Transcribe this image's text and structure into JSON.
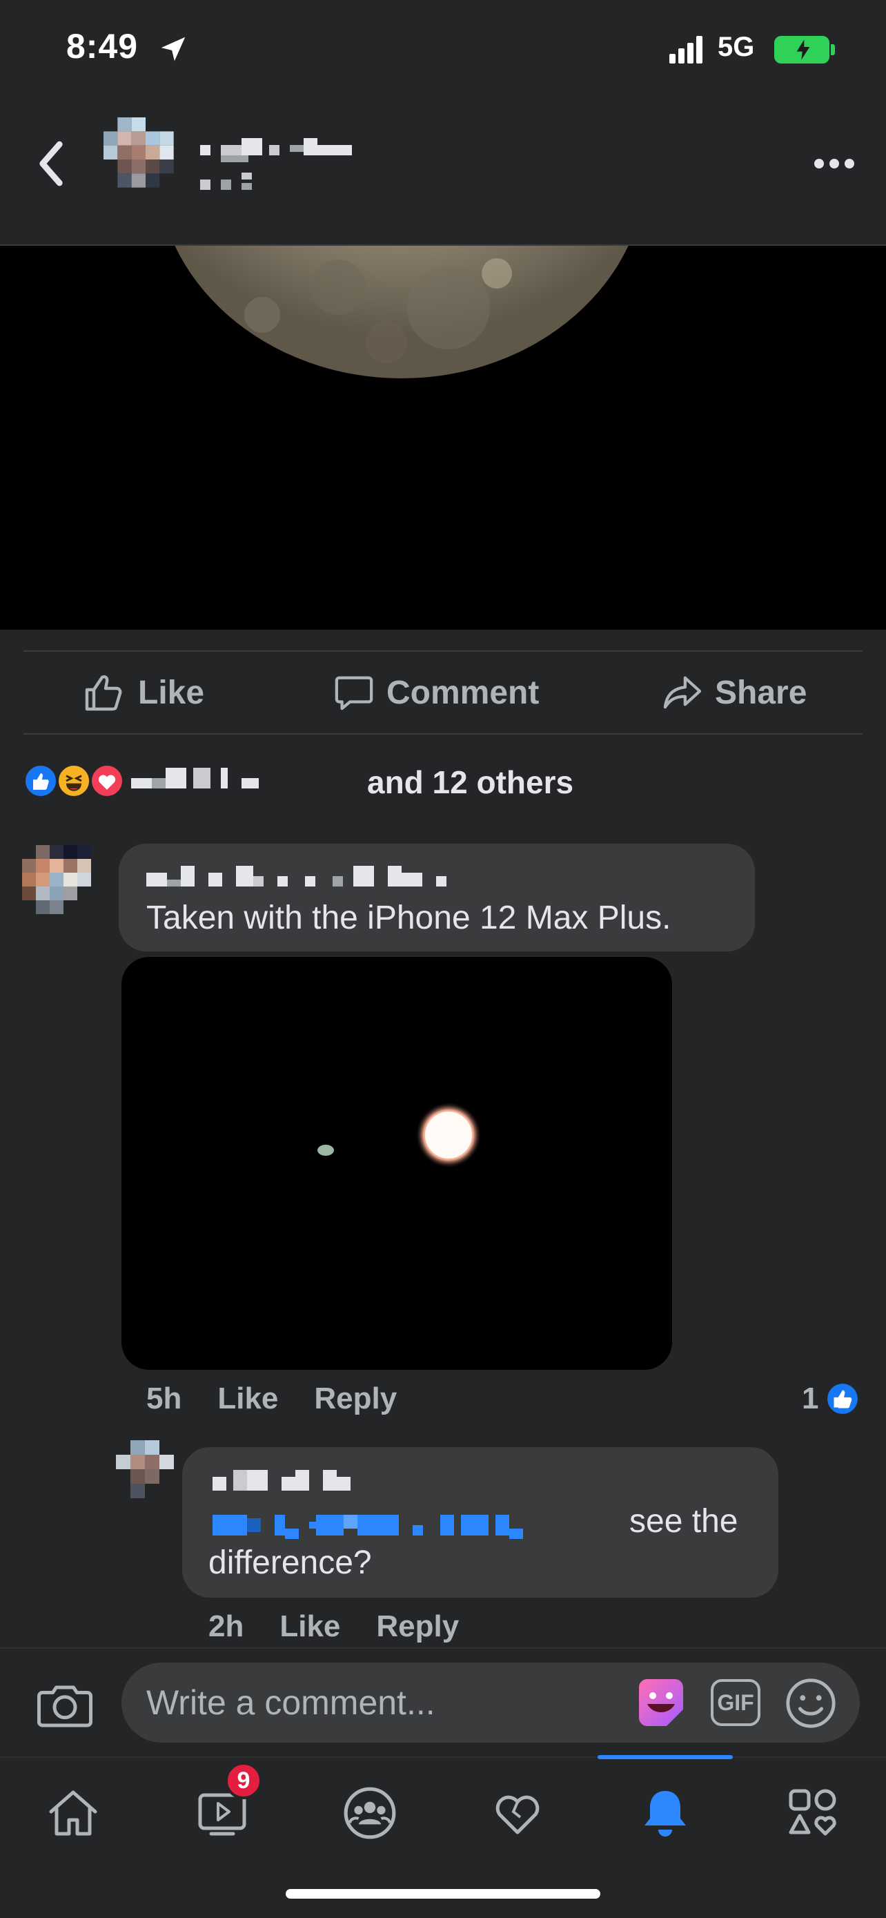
{
  "status_bar": {
    "time": "8:49",
    "network": "5G",
    "icons": [
      "location-arrow-icon",
      "signal-icon",
      "battery-charging-icon"
    ]
  },
  "header": {
    "icons": [
      "chevron-left-icon",
      "more-horizontal-icon"
    ]
  },
  "actions": {
    "like": "Like",
    "comment": "Comment",
    "share": "Share"
  },
  "reactions": {
    "summary": "and 12 others",
    "icons": [
      "like-reaction-icon",
      "haha-reaction-icon",
      "love-reaction-icon"
    ],
    "colors": {
      "like": "#1877f2",
      "haha": "#f7b125",
      "love": "#f33e58"
    }
  },
  "comments": [
    {
      "text": "Taken with the iPhone 12 Max Plus.",
      "time": "5h",
      "like_label": "Like",
      "reply_label": "Reply",
      "like_count": "1"
    },
    {
      "text_line1": "see the",
      "text_line2": "difference?",
      "time": "2h",
      "like_label": "Like",
      "reply_label": "Reply"
    }
  ],
  "composer": {
    "placeholder": "Write a comment...",
    "gif_label": "GIF"
  },
  "tabbar": {
    "items": [
      "home-icon",
      "video-icon",
      "groups-icon",
      "dating-heart-icon",
      "notifications-bell-icon",
      "menu-icon"
    ],
    "video_badge": "9",
    "active": "notifications-bell-icon",
    "accent": "#2d88ff"
  }
}
